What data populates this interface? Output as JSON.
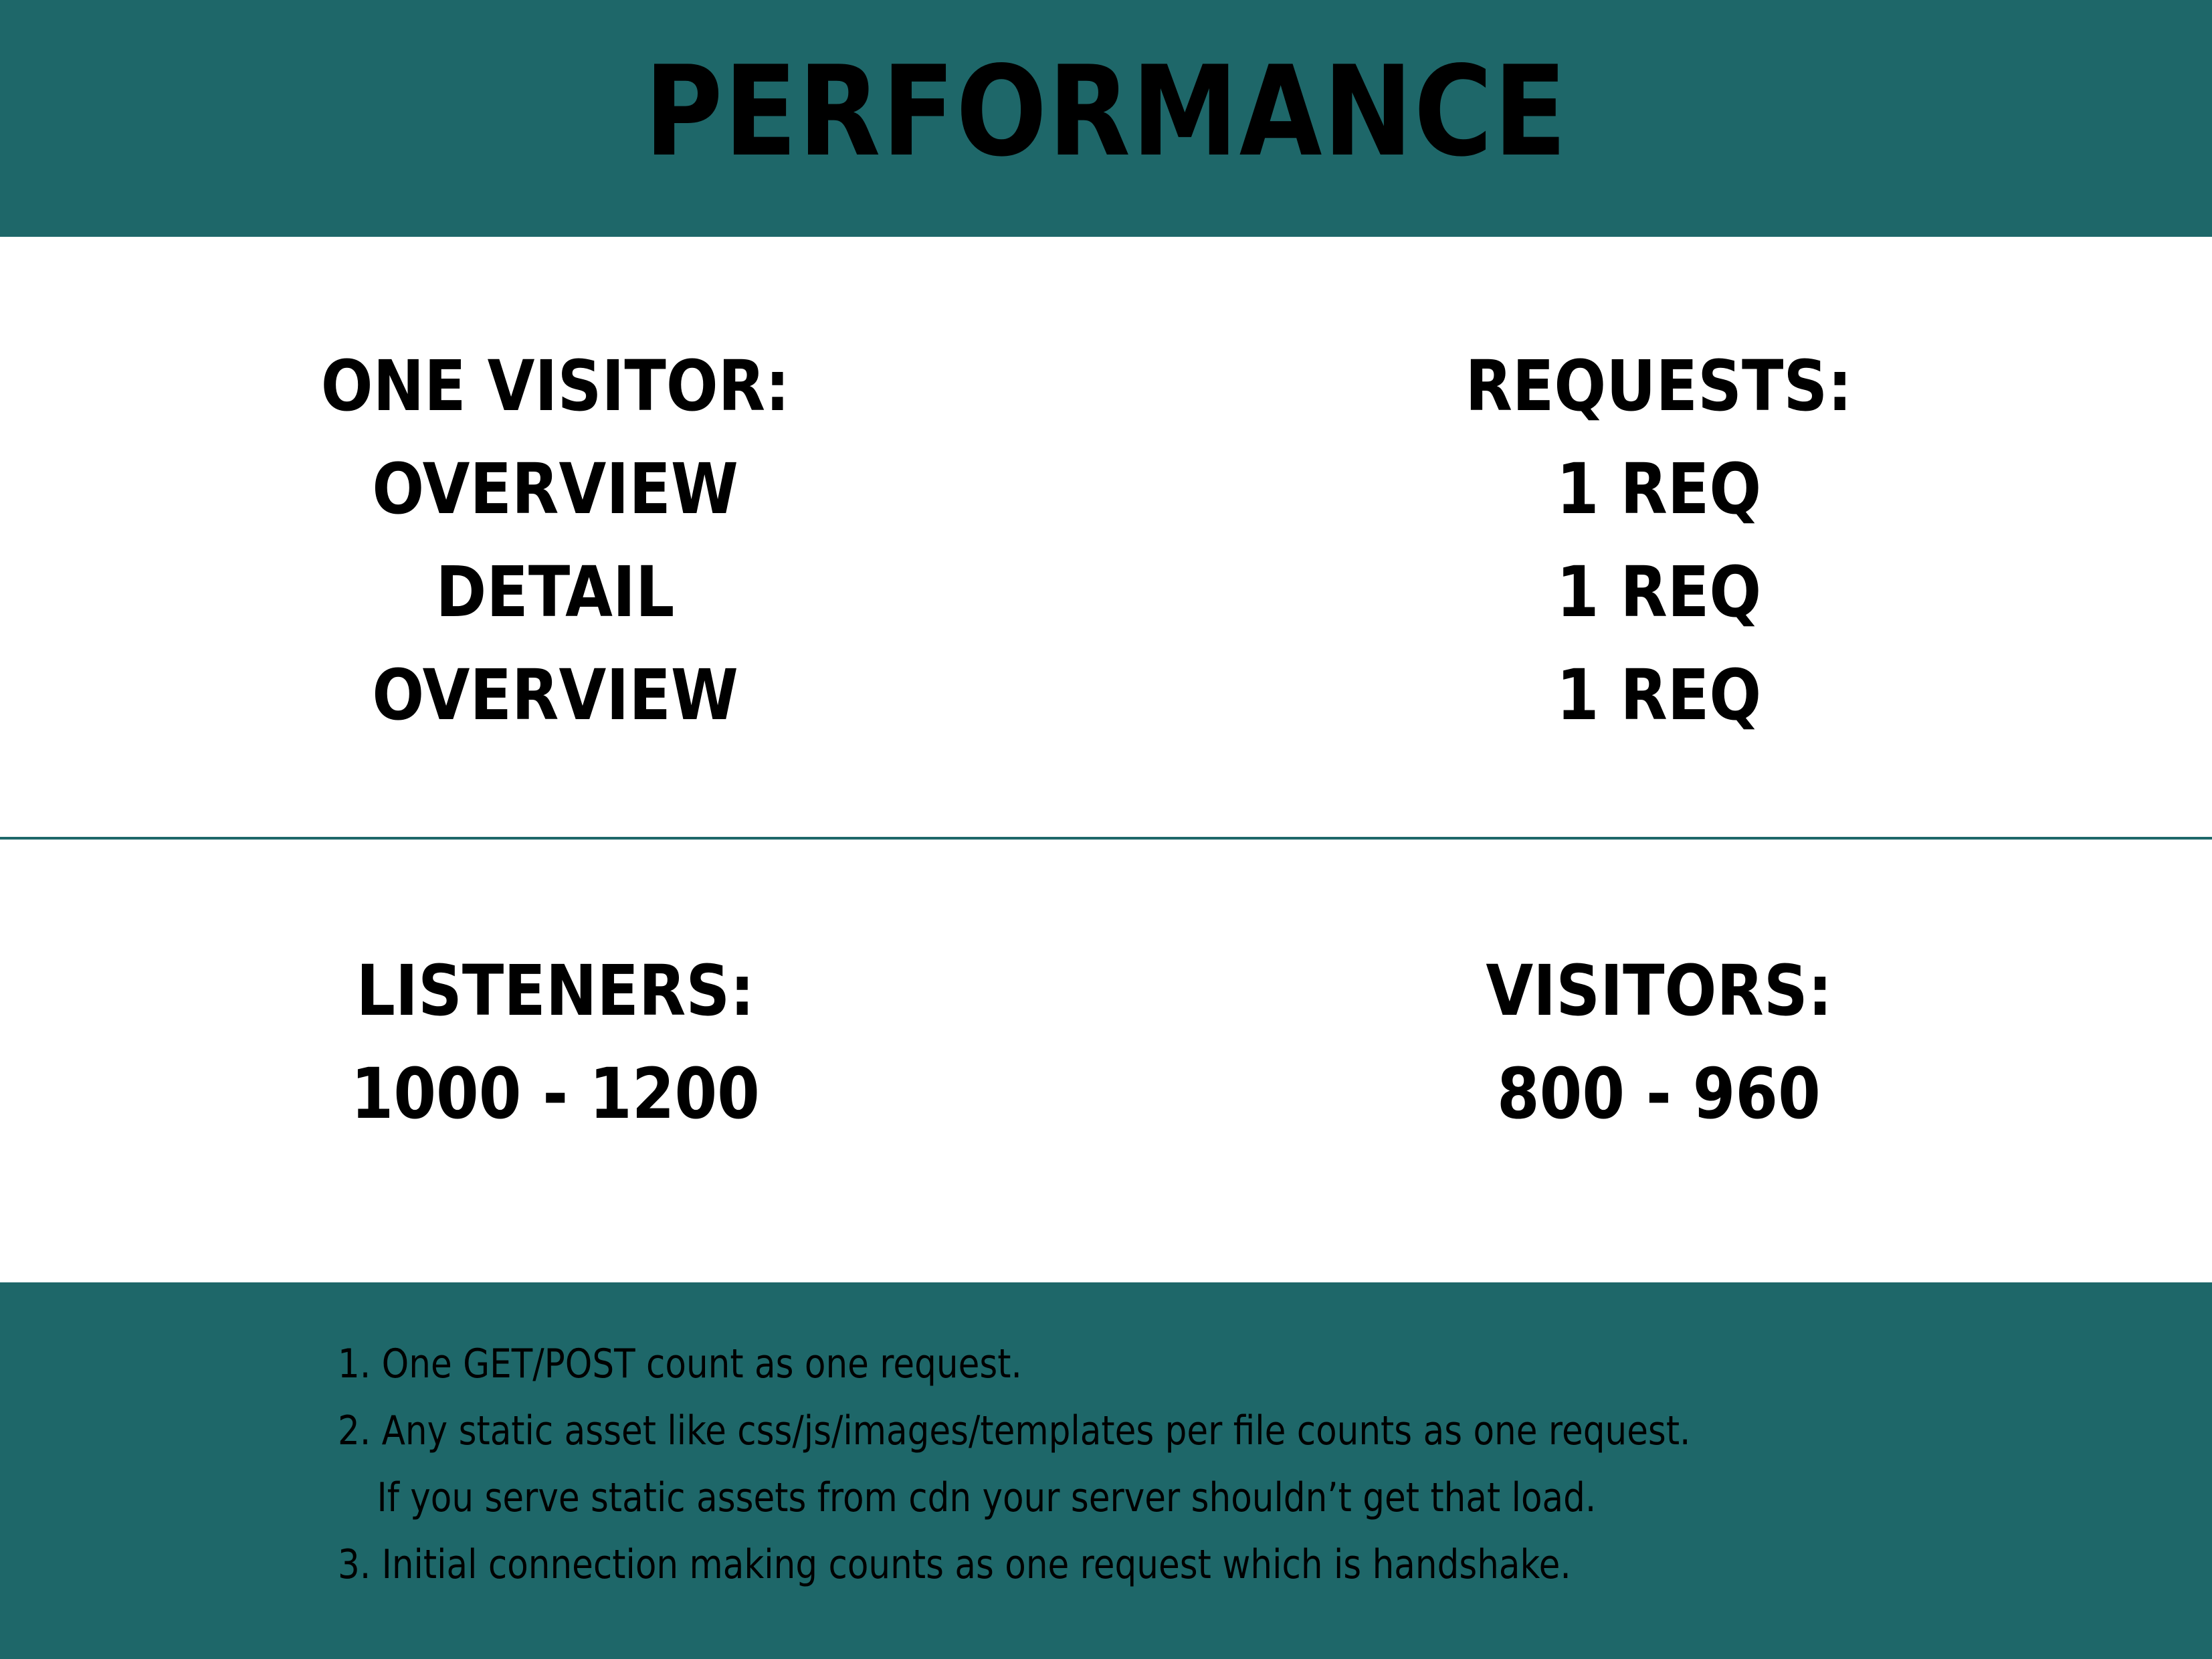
{
  "header": {
    "title": "PERFORMANCE"
  },
  "top_section": {
    "left": {
      "heading": "ONE VISITOR:",
      "items": [
        "OVERVIEW",
        "DETAIL",
        "OVERVIEW"
      ]
    },
    "right": {
      "heading": "REQUESTS:",
      "items": [
        "1 REQ",
        "1 REQ",
        "1 REQ"
      ]
    }
  },
  "bottom_section": {
    "left": {
      "heading": "LISTENERS:",
      "value": "1000 - 1200"
    },
    "right": {
      "heading": "VISITORS:",
      "value": "800 - 960"
    }
  },
  "footer": {
    "notes": [
      "1. One GET/POST count as one request.",
      "2. Any static asset like css/js/images/templates per file counts as one request.",
      "If you serve static assets from cdn your server shouldn’t get that load.",
      "3. Initial connection making counts as one request which is handshake."
    ]
  },
  "colors": {
    "accent": "#1e6769",
    "background": "#ffffff",
    "text": "#000000"
  }
}
